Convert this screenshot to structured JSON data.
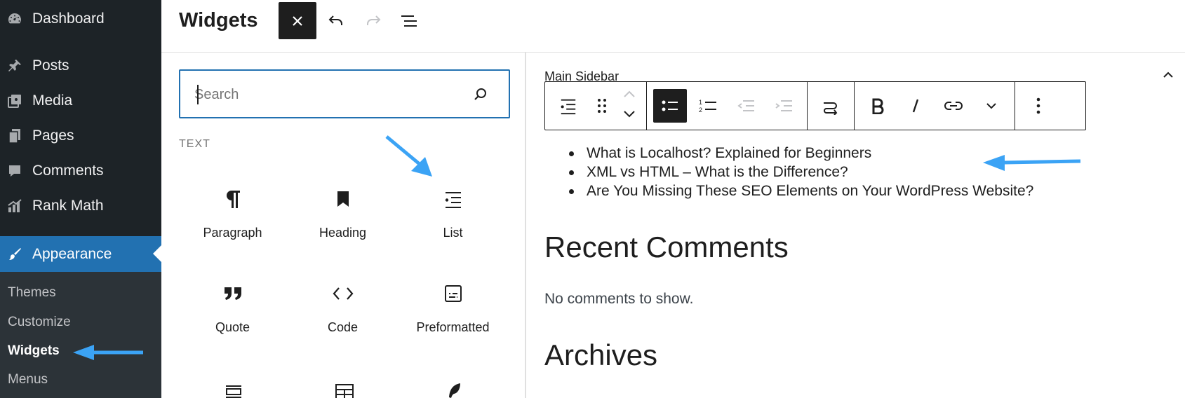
{
  "sidebar": {
    "items": [
      {
        "label": "Dashboard",
        "icon": "dashboard-icon"
      },
      {
        "label": "Posts",
        "icon": "pin-icon"
      },
      {
        "label": "Media",
        "icon": "media-icon"
      },
      {
        "label": "Pages",
        "icon": "pages-icon"
      },
      {
        "label": "Comments",
        "icon": "comment-icon"
      },
      {
        "label": "Rank Math",
        "icon": "rank-math-icon"
      },
      {
        "label": "Appearance",
        "icon": "paintbrush-icon"
      }
    ],
    "submenu": [
      "Themes",
      "Customize",
      "Widgets",
      "Menus"
    ],
    "current_submenu": "Widgets"
  },
  "header": {
    "title": "Widgets"
  },
  "inserter": {
    "search_placeholder": "Search",
    "category": "TEXT",
    "blocks": [
      {
        "label": "Paragraph",
        "icon": "paragraph-icon"
      },
      {
        "label": "Heading",
        "icon": "bookmark-icon"
      },
      {
        "label": "List",
        "icon": "list-icon"
      },
      {
        "label": "Quote",
        "icon": "quote-icon"
      },
      {
        "label": "Code",
        "icon": "code-icon"
      },
      {
        "label": "Preformatted",
        "icon": "preformatted-icon"
      }
    ]
  },
  "editor": {
    "area_title": "Main Sidebar",
    "recent_posts": [
      "What is Localhost? Explained for Beginners",
      "XML vs HTML – What is the Difference?",
      "Are You Missing These SEO Elements on Your WordPress Website?"
    ],
    "recent_comments_heading": "Recent Comments",
    "no_comments_text": "No comments to show.",
    "archives_heading": "Archives"
  },
  "colors": {
    "sidebar_bg": "#1d2327",
    "active_blue": "#2271b1",
    "annotation_arrow": "#3ba3f5"
  }
}
